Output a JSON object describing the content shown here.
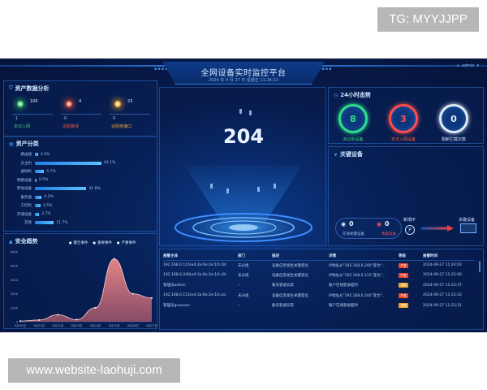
{
  "watermark_top": "TG: MYYJJPP",
  "watermark_bottom": "www.website-laohuji.com",
  "header": {
    "title": "全网设备实时监控平台",
    "subtitle": "2024 年 9 月 27 日 星期五 11:24:22",
    "user": "admin"
  },
  "assets": {
    "title": "资产数据分析",
    "stats": [
      {
        "num": "100",
        "sub": "1",
        "label": "未识入网",
        "color": "#3bd16f"
      },
      {
        "num": "4",
        "sub": "0",
        "label": "识别离线",
        "color": "#ff5a3a"
      },
      {
        "num": "23",
        "sub": "0",
        "label": "识别未接口",
        "color": "#ffb02e"
      }
    ]
  },
  "categories": {
    "title": "资产分类",
    "items": [
      {
        "name": "路由器",
        "pct": "2.0%",
        "value": 2.0
      },
      {
        "name": "云主机",
        "pct": "41.1%",
        "value": 41.1
      },
      {
        "name": "虚拟机",
        "pct": "5.7%",
        "value": 5.7
      },
      {
        "name": "网络设备",
        "pct": "0.5%",
        "value": 0.5
      },
      {
        "name": "移动设备",
        "pct": "31.8%",
        "value": 31.8
      },
      {
        "name": "服务器",
        "pct": "4.2%",
        "value": 4.2
      },
      {
        "name": "工控机",
        "pct": "3.5%",
        "value": 3.5
      },
      {
        "name": "存储设备",
        "pct": "2.7%",
        "value": 2.7
      },
      {
        "name": "其他",
        "pct": "11.7%",
        "value": 11.7
      }
    ]
  },
  "trend": {
    "title": "安全趋势",
    "legend": [
      "警告事件",
      "重要事件",
      "严重事件"
    ]
  },
  "chart_data": {
    "type": "area",
    "title": "安全趋势",
    "x": [
      "9月20日",
      "9月21日",
      "9月22日",
      "9月23日",
      "9月24日",
      "9月25日",
      "9月26日",
      "9月27日"
    ],
    "yticks": [
      0,
      1000,
      2000,
      3000,
      4000,
      5000
    ],
    "ylim": [
      0,
      5000
    ],
    "series": [
      {
        "name": "严重事件",
        "values": [
          50,
          120,
          500,
          150,
          1000,
          4500,
          2000,
          1700
        ]
      }
    ],
    "legend_position": "top-right",
    "grid": false
  },
  "center": {
    "value": "204"
  },
  "status24": {
    "title": "24小时态势",
    "rings": [
      {
        "value": "8",
        "label": "未识别设备",
        "color": "#2fe08a",
        "labelColor": "#3bd16f"
      },
      {
        "value": "3",
        "label": "非法入网设备",
        "color": "#ff4d4f",
        "labelColor": "#ff5a3a"
      },
      {
        "value": "0",
        "label": "阻断拦截次数",
        "color": "#dfe9f7",
        "labelColor": "#cfe6ff"
      }
    ]
  },
  "keydev": {
    "title": "关键设备",
    "online": "0",
    "online_label": "在线关键设备",
    "offline": "0",
    "offline_label": "失联设备",
    "ip_label": "新增IP",
    "switch_label": "关键设备"
  },
  "table": {
    "headers": [
      "报警主体",
      "部门",
      "描述",
      "详情",
      "等级",
      "报警时间"
    ],
    "rows": [
      {
        "subject": "192.168.0.115(e4:3a:6e:2e:10:c9)",
        "dept": "未分组",
        "desc": "设备信息发生关键变化",
        "detail": "IP地址从\"192.168.0.240\"变为\"...",
        "level": "严重",
        "levelColor": "#e8472e",
        "time": "2024-09-27 11:24:03"
      },
      {
        "subject": "192.168.0.240(e4:3a:6e:2e:10:c9)",
        "dept": "未分组",
        "desc": "设备信息发生关键变化",
        "detail": "IP地址从\"192.168.0.115\"变为\"...",
        "level": "严重",
        "levelColor": "#e8472e",
        "time": "2024-09-27 11:23:40"
      },
      {
        "subject": "管理员admin",
        "dept": "--",
        "desc": "账号登录异常",
        "detail": "账户在线登录超时",
        "level": "重要",
        "levelColor": "#f0a12a",
        "time": "2024-09-27 11:23:37"
      },
      {
        "subject": "192.168.0.115(e4:3a:6e:2e:10:ca)",
        "dept": "未分组",
        "desc": "设备信息发生关键变化",
        "detail": "IP地址从\"192.168.0.240\"变为\"...",
        "level": "严重",
        "levelColor": "#e8472e",
        "time": "2024-09-27 11:23:33"
      },
      {
        "subject": "管理员gnosnon",
        "dept": "--",
        "desc": "账号登录异常",
        "detail": "账户在线登录超时",
        "level": "重要",
        "levelColor": "#f0a12a",
        "time": "2024-09-27 11:23:31"
      }
    ]
  }
}
